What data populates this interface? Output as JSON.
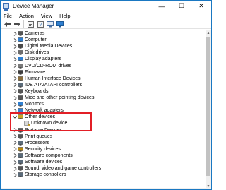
{
  "window": {
    "title": "Device Manager"
  },
  "controls": {
    "minimize": "—",
    "maximize": "☐",
    "close": "✕"
  },
  "menu": [
    "File",
    "Action",
    "View",
    "Help"
  ],
  "toolbar": [
    "back-icon",
    "forward-icon",
    "properties-icon",
    "help-icon",
    "update-driver-icon",
    "monitor-icon"
  ],
  "tree": {
    "categories": [
      {
        "label": "Cameras",
        "icon": "camera-icon",
        "color": "#555555"
      },
      {
        "label": "Computer",
        "icon": "computer-icon",
        "color": "#2f7fd0"
      },
      {
        "label": "Digital Media Devices",
        "icon": "media-device-icon",
        "color": "#4a4a4a"
      },
      {
        "label": "Disk drives",
        "icon": "disk-icon",
        "color": "#6d6d6d"
      },
      {
        "label": "Display adapters",
        "icon": "display-adapter-icon",
        "color": "#2f7fd0"
      },
      {
        "label": "DVD/CD-ROM drives",
        "icon": "dvd-icon",
        "color": "#7a7a7a"
      },
      {
        "label": "Firmware",
        "icon": "firmware-icon",
        "color": "#3d3d3d"
      },
      {
        "label": "Human Interface Devices",
        "icon": "hid-icon",
        "color": "#8a6d3b"
      },
      {
        "label": "IDE ATA/ATAPI controllers",
        "icon": "ide-icon",
        "color": "#5a6b7a"
      },
      {
        "label": "Keyboards",
        "icon": "keyboard-icon",
        "color": "#555555"
      },
      {
        "label": "Mice and other pointing devices",
        "icon": "mouse-icon",
        "color": "#555555"
      },
      {
        "label": "Monitors",
        "icon": "monitor-icon",
        "color": "#2f7fd0"
      },
      {
        "label": "Network adapters",
        "icon": "network-icon",
        "color": "#2f7fd0"
      },
      {
        "label": "Other devices",
        "icon": "other-devices-icon",
        "color": "#c9a227",
        "expanded": true
      },
      {
        "label": "Portable Devices",
        "icon": "portable-device-icon",
        "color": "#555555"
      },
      {
        "label": "Print queues",
        "icon": "printer-icon",
        "color": "#555555"
      },
      {
        "label": "Processors",
        "icon": "processor-icon",
        "color": "#5a6b7a"
      },
      {
        "label": "Security devices",
        "icon": "security-device-icon",
        "color": "#b8860b"
      },
      {
        "label": "Software components",
        "icon": "software-component-icon",
        "color": "#5a6b7a"
      },
      {
        "label": "Software devices",
        "icon": "software-device-icon",
        "color": "#5a6b7a"
      },
      {
        "label": "Sound, video and game controllers",
        "icon": "sound-icon",
        "color": "#555555"
      },
      {
        "label": "Storage controllers",
        "icon": "storage-icon",
        "color": "#5a6b7a"
      }
    ],
    "child": {
      "label": "Unknown device",
      "icon": "unknown-device-warning-icon",
      "color": "#c9a227"
    }
  }
}
